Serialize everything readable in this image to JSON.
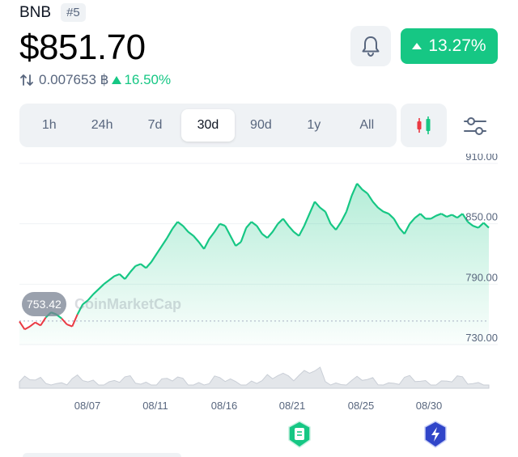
{
  "header": {
    "symbol": "BNB",
    "rank": "#5"
  },
  "price": {
    "usd": "$851.70",
    "btc": "0.007653 ฿",
    "btc_change": "16.50%",
    "change_badge": "13.27%"
  },
  "icons": {
    "alert": "bell-icon",
    "swap": "swap-arrows-icon",
    "candle": "candlestick-icon",
    "settings": "sliders-icon"
  },
  "tabs": [
    {
      "label": "1h"
    },
    {
      "label": "24h"
    },
    {
      "label": "7d"
    },
    {
      "label": "30d",
      "active": true
    },
    {
      "label": "90d"
    },
    {
      "label": "1y"
    },
    {
      "label": "All"
    }
  ],
  "colors": {
    "up": "#16c784",
    "down": "#ea3943",
    "text_secondary": "#58667e",
    "bg_secondary": "#eff2f5"
  },
  "chart": {
    "open_price_label": "753.42",
    "watermark": "CoinMarketCap"
  },
  "chart_data": {
    "type": "area",
    "ylim": [
      730,
      910
    ],
    "y_ticks": [
      "910.00",
      "850.00",
      "790.00",
      "730.00"
    ],
    "x_ticks": [
      "08/07",
      "08/11",
      "08/16",
      "08/21",
      "08/25",
      "08/30"
    ],
    "baseline": 753.42,
    "series": [
      {
        "values": [
          753,
          745,
          748,
          752,
          749,
          757,
          762,
          760,
          756,
          750,
          748,
          760,
          770,
          774,
          780,
          785,
          790,
          794,
          798,
          800,
          795,
          802,
          808,
          810,
          806,
          812,
          820,
          828,
          836,
          845,
          852,
          848,
          842,
          838,
          832,
          825,
          835,
          842,
          850,
          848,
          838,
          828,
          832,
          846,
          852,
          848,
          840,
          836,
          842,
          850,
          855,
          848,
          842,
          838,
          848,
          860,
          872,
          866,
          862,
          850,
          844,
          852,
          862,
          878,
          890,
          884,
          880,
          872,
          866,
          862,
          860,
          855,
          846,
          840,
          850,
          856,
          860,
          855,
          855,
          858,
          860,
          857,
          859,
          856,
          860,
          852,
          848,
          846,
          851,
          846
        ]
      }
    ]
  },
  "events": {
    "news": "news-event-icon",
    "flash": "flash-event-icon"
  }
}
